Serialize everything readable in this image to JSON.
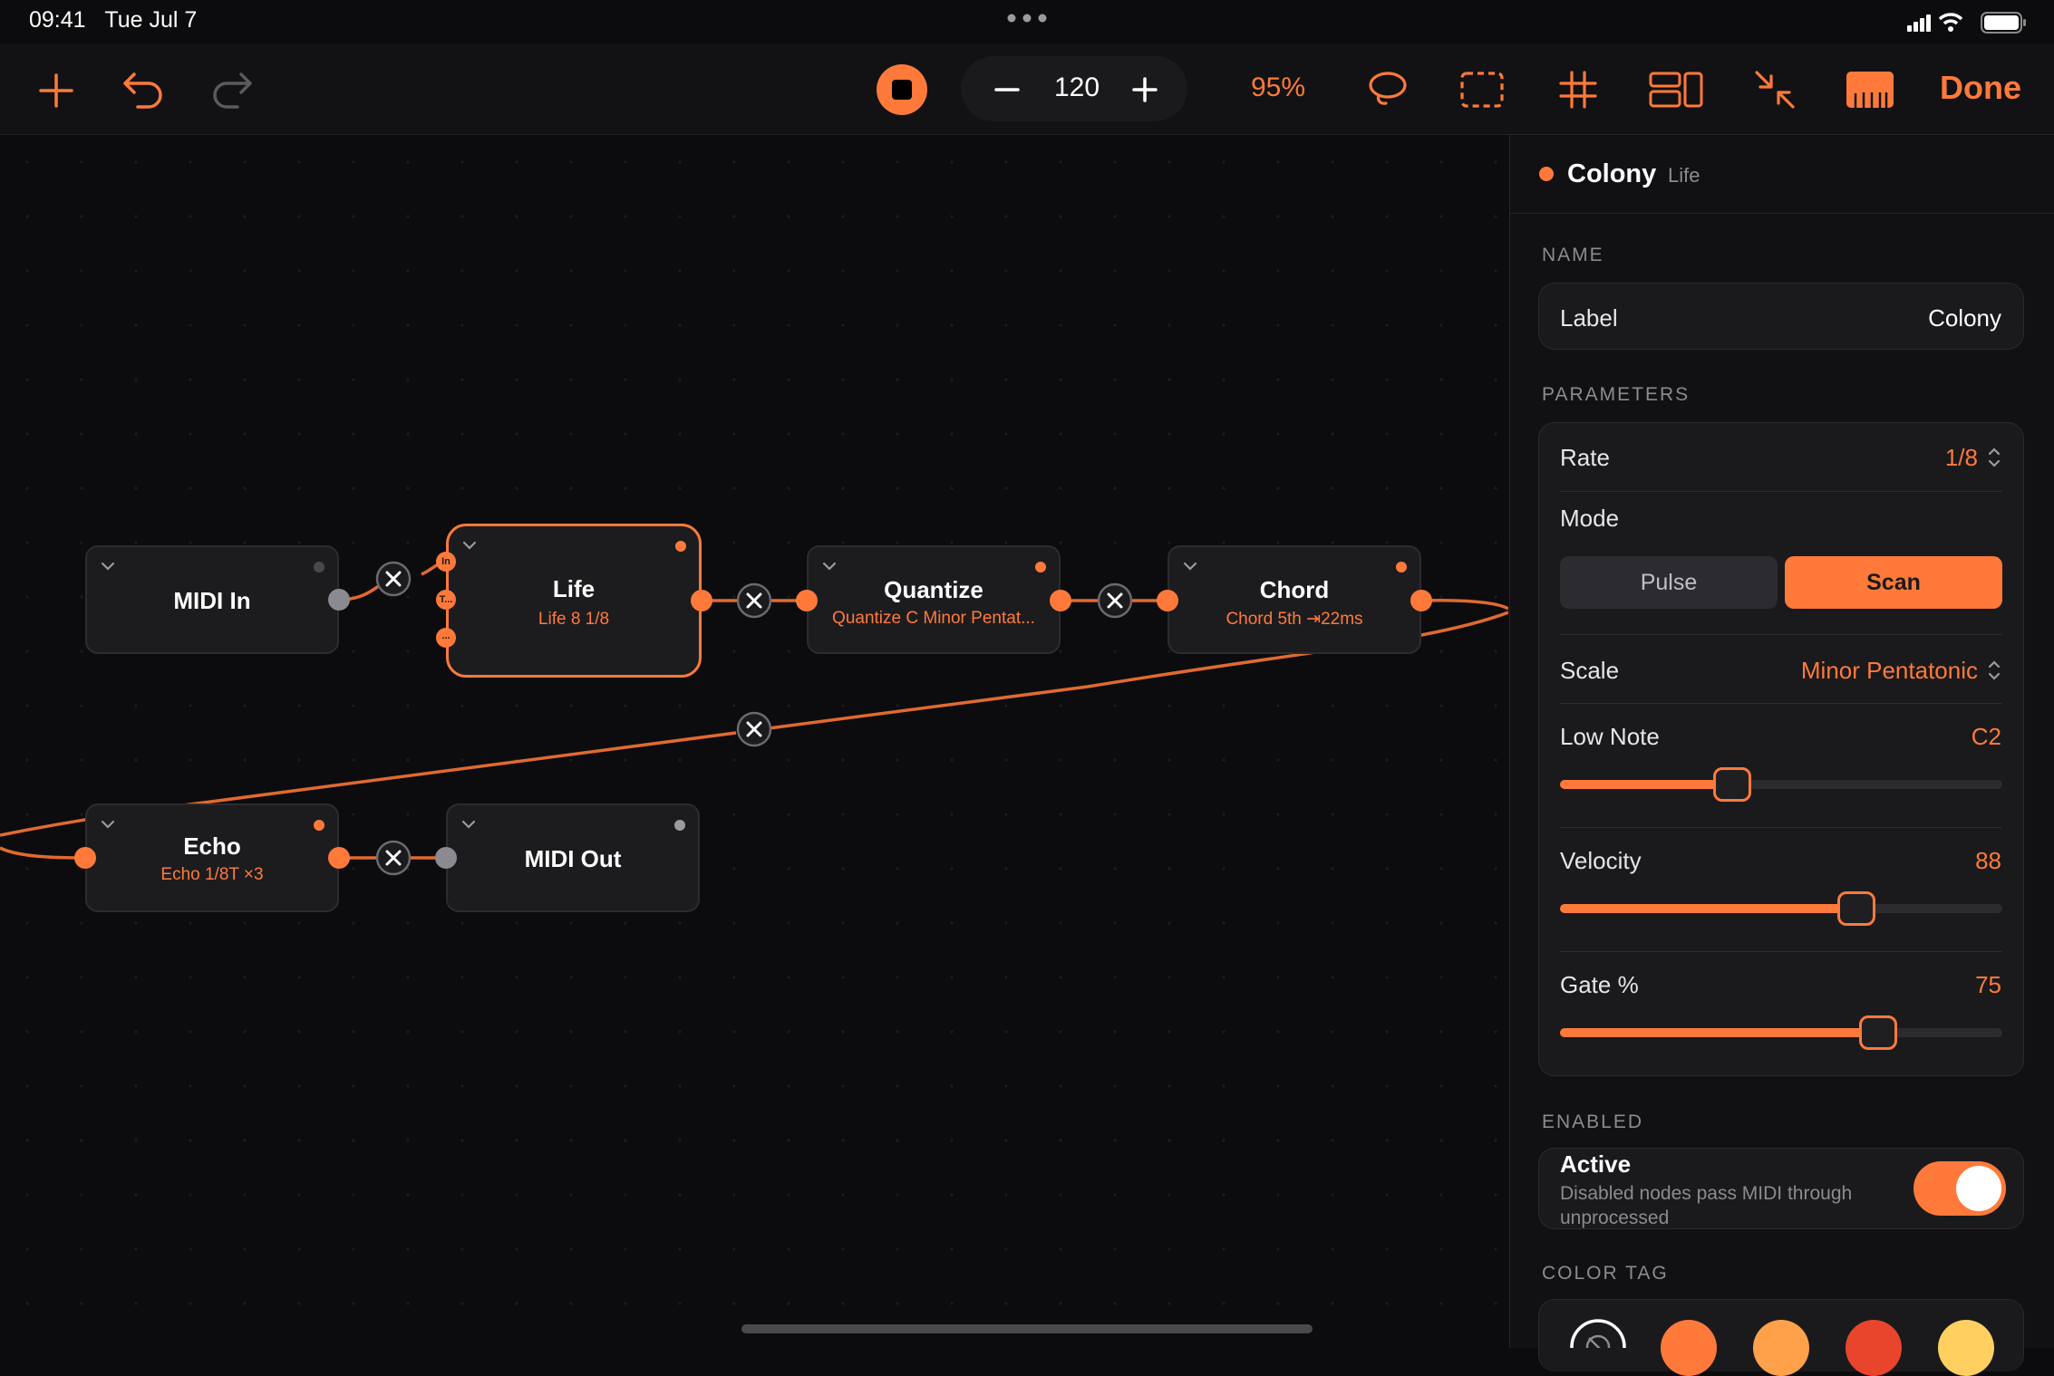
{
  "status": {
    "time": "09:41",
    "date": "Tue Jul 7"
  },
  "toolbar": {
    "tempo": "120",
    "zoom": "95%",
    "done": "Done"
  },
  "nodes": {
    "midi_in": {
      "title": "MIDI In"
    },
    "life": {
      "title": "Life",
      "subtitle": "Life 8 1/8",
      "ports": [
        "In",
        "T...",
        "..."
      ]
    },
    "quantize": {
      "title": "Quantize",
      "subtitle": "Quantize C Minor Pentat..."
    },
    "chord": {
      "title": "Chord",
      "subtitle": "Chord 5th ⇥22ms"
    },
    "echo": {
      "title": "Echo",
      "subtitle": "Echo 1/8T ×3"
    },
    "midi_out": {
      "title": "MIDI Out"
    }
  },
  "panel": {
    "title": "Colony",
    "subtitle": "Life",
    "name_section": "NAME",
    "label": {
      "label": "Label",
      "value": "Colony"
    },
    "params_section": "PARAMETERS",
    "rate": {
      "label": "Rate",
      "value": "1/8"
    },
    "mode": {
      "label": "Mode",
      "options": [
        "Pulse",
        "Scan"
      ],
      "selected": "Scan"
    },
    "scale": {
      "label": "Scale",
      "value": "Minor Pentatonic"
    },
    "low_note": {
      "label": "Low Note",
      "value": "C2",
      "fraction": 0.39
    },
    "velocity": {
      "label": "Velocity",
      "value": "88",
      "fraction": 0.67
    },
    "gate": {
      "label": "Gate %",
      "value": "75",
      "fraction": 0.72
    },
    "enabled_section": "ENABLED",
    "active": {
      "label": "Active",
      "description": "Disabled nodes pass MIDI through unprocessed",
      "on": true
    },
    "color_section": "COLOR TAG",
    "colors": [
      "#ff7a3a",
      "#ffa14a",
      "#e8452c",
      "#ffd060"
    ]
  },
  "accent": "#ff7a3a"
}
